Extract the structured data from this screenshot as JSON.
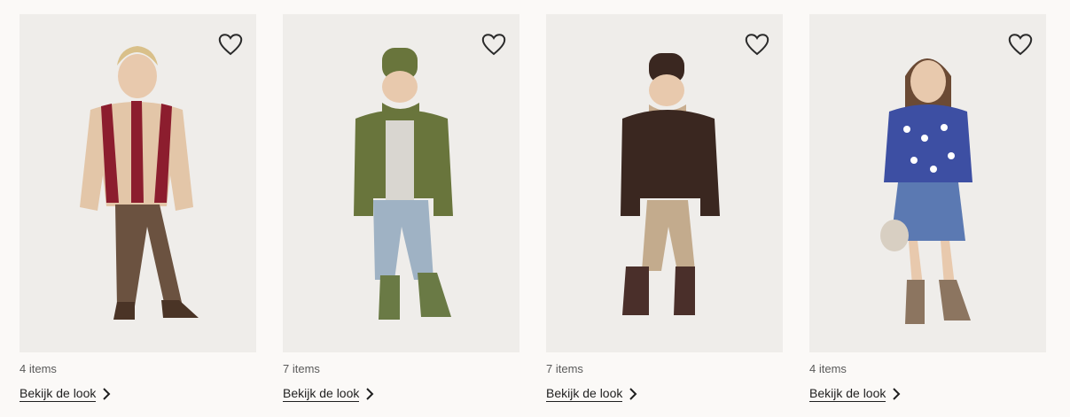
{
  "looks": [
    {
      "count": "4 items",
      "cta": "Bekijk de look",
      "colors": {
        "top": "#8c1d2e",
        "top2": "#e3c6a8",
        "bottom": "#6b5240",
        "boots": "#4a3426",
        "hat": "",
        "hair": "#d9c08a"
      }
    },
    {
      "count": "7 items",
      "cta": "Bekijk de look",
      "colors": {
        "top": "#69753c",
        "top2": "#d9d6d0",
        "bottom": "#9fb2c4",
        "boots": "#6a7a45",
        "hat": "#69753c",
        "hair": ""
      }
    },
    {
      "count": "7 items",
      "cta": "Bekijk de look",
      "colors": {
        "top": "#3a2720",
        "top2": "#c8ad8f",
        "bottom": "#c3ab8d",
        "boots": "#4a2f2a",
        "hat": "#3a2720",
        "hair": ""
      }
    },
    {
      "count": "4 items",
      "cta": "Bekijk de look",
      "colors": {
        "top": "#3d4fa3",
        "top2": "#ffffff",
        "bottom": "#5b79b2",
        "boots": "#8c7560",
        "hat": "",
        "hair": "#6b4a34"
      }
    }
  ]
}
